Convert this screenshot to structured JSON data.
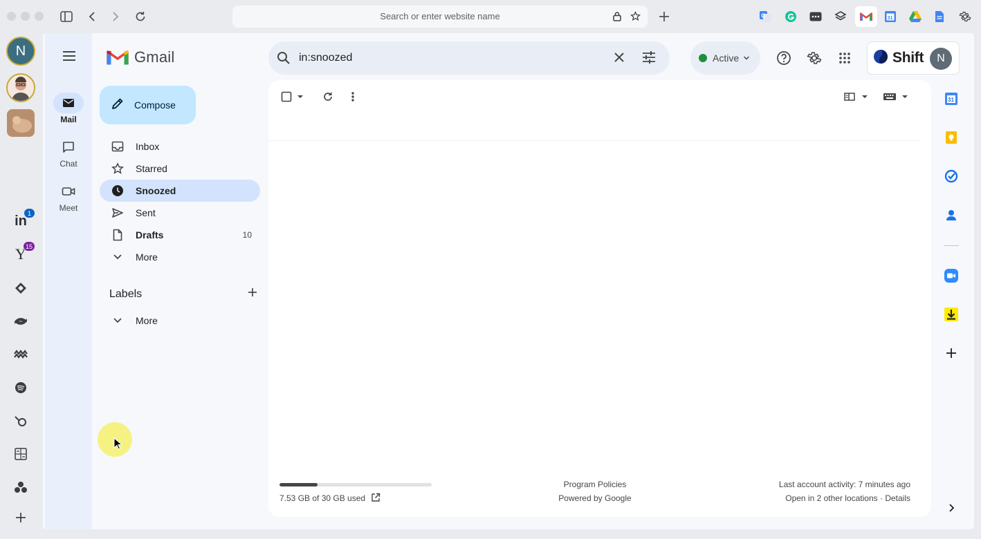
{
  "browser": {
    "url_placeholder": "Search or enter website name"
  },
  "app_rail": {
    "avatar_letter": "N",
    "linkedin_badge": "1",
    "yahoo_badge": "15"
  },
  "gmail": {
    "logo_text": "Gmail",
    "modes": [
      {
        "label": "Mail"
      },
      {
        "label": "Chat"
      },
      {
        "label": "Meet"
      }
    ],
    "compose_label": "Compose",
    "nav": [
      {
        "label": "Inbox",
        "count": ""
      },
      {
        "label": "Starred",
        "count": ""
      },
      {
        "label": "Snoozed",
        "count": ""
      },
      {
        "label": "Sent",
        "count": ""
      },
      {
        "label": "Drafts",
        "count": "10"
      },
      {
        "label": "More",
        "count": ""
      }
    ],
    "labels_heading": "Labels",
    "labels_more": "More",
    "search_value": "in:snoozed",
    "status_label": "Active",
    "shift_name": "Shift",
    "account_letter": "N",
    "storage_text": "7.53 GB of 30 GB used",
    "storage_fraction": 0.251,
    "footer_policies": "Program Policies",
    "footer_powered": "Powered by Google",
    "footer_activity": "Last account activity: 7 minutes ago",
    "footer_locations": "Open in 2 other locations · Details"
  },
  "colors": {
    "accent": "#0b57d0",
    "compose_bg": "#c2e7ff",
    "active_nav_bg": "#d3e3fd",
    "status_green": "#1e8e3e"
  }
}
